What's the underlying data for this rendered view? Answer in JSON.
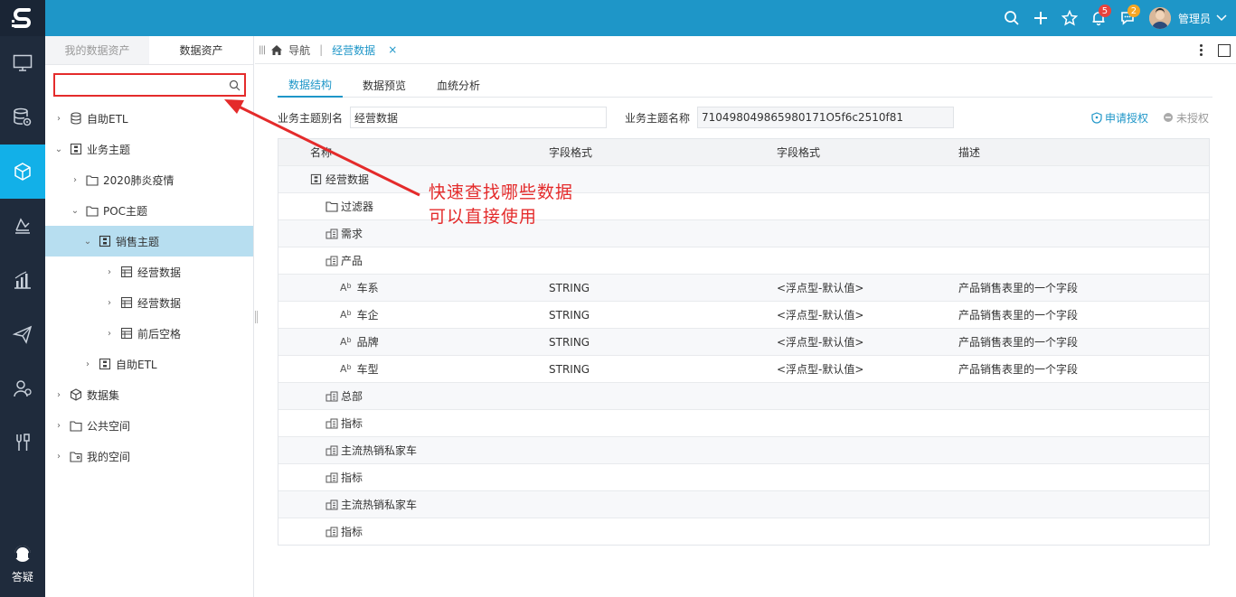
{
  "app": {
    "logo_icon": "s-logo-icon"
  },
  "topbar": {
    "notifications_count": "5",
    "messages_count": "2",
    "user_name": "管理员",
    "accent": "#1e96c8"
  },
  "rail": {
    "items": [
      "monitor-icon",
      "database-settings-icon",
      "cube-icon",
      "analysis-icon",
      "bar-chart-icon",
      "send-icon",
      "users-icon",
      "tools-icon"
    ],
    "bottom_label": "答疑"
  },
  "panel": {
    "tabs": [
      "我的数据资产",
      "数据资产"
    ],
    "search": {
      "value": "",
      "placeholder": ""
    },
    "tree": [
      {
        "label": "自助ETL"
      },
      {
        "label": "业务主题"
      },
      {
        "label": "2020肺炎疫情"
      },
      {
        "label": "POC主题"
      },
      {
        "label": "销售主题"
      },
      {
        "label": "经营数据"
      },
      {
        "label": "经营数据"
      },
      {
        "label": "前后空格"
      },
      {
        "label": "自助ETL"
      },
      {
        "label": "数据集"
      },
      {
        "label": "公共空间"
      },
      {
        "label": "我的空间"
      }
    ]
  },
  "tabbar": {
    "home_label": "导航",
    "active_tab": "经营数据",
    "close_glyph": "×"
  },
  "subtabs": [
    "数据结构",
    "数据预览",
    "血统分析"
  ],
  "form": {
    "alias_label": "业务主题别名",
    "alias_value": "经营数据",
    "name_label": "业务主题名称",
    "name_value": "710498049865980171O5f6c2510f81",
    "apply_label": "申请授权",
    "unauth_label": "未授权"
  },
  "grid": {
    "headers": [
      "名称",
      "字段格式",
      "字段格式",
      "描述"
    ],
    "rows": [
      {
        "name": "经营数据",
        "c2": "",
        "c3": "",
        "c4": ""
      },
      {
        "name": "过滤器",
        "c2": "",
        "c3": "",
        "c4": ""
      },
      {
        "name": "需求",
        "c2": "",
        "c3": "",
        "c4": ""
      },
      {
        "name": "产品",
        "c2": "",
        "c3": "",
        "c4": ""
      },
      {
        "name": "车系",
        "c2": "STRING",
        "c3": "<浮点型-默认值>",
        "c4": "产品销售表里的一个字段"
      },
      {
        "name": "车企",
        "c2": "STRING",
        "c3": "<浮点型-默认值>",
        "c4": "产品销售表里的一个字段"
      },
      {
        "name": "品牌",
        "c2": "STRING",
        "c3": "<浮点型-默认值>",
        "c4": "产品销售表里的一个字段"
      },
      {
        "name": "车型",
        "c2": "STRING",
        "c3": "<浮点型-默认值>",
        "c4": "产品销售表里的一个字段"
      },
      {
        "name": "总部",
        "c2": "",
        "c3": "",
        "c4": ""
      },
      {
        "name": "指标",
        "c2": "",
        "c3": "",
        "c4": ""
      },
      {
        "name": "主流热销私家车",
        "c2": "",
        "c3": "",
        "c4": ""
      },
      {
        "name": "指标",
        "c2": "",
        "c3": "",
        "c4": ""
      },
      {
        "name": "主流热销私家车",
        "c2": "",
        "c3": "",
        "c4": ""
      },
      {
        "name": "指标",
        "c2": "",
        "c3": "",
        "c4": ""
      }
    ],
    "field_type_glyph": "Ab"
  },
  "annotation": {
    "line1": "快速查找哪些数据",
    "line2": "可以直接使用",
    "color": "#e42b2b"
  }
}
